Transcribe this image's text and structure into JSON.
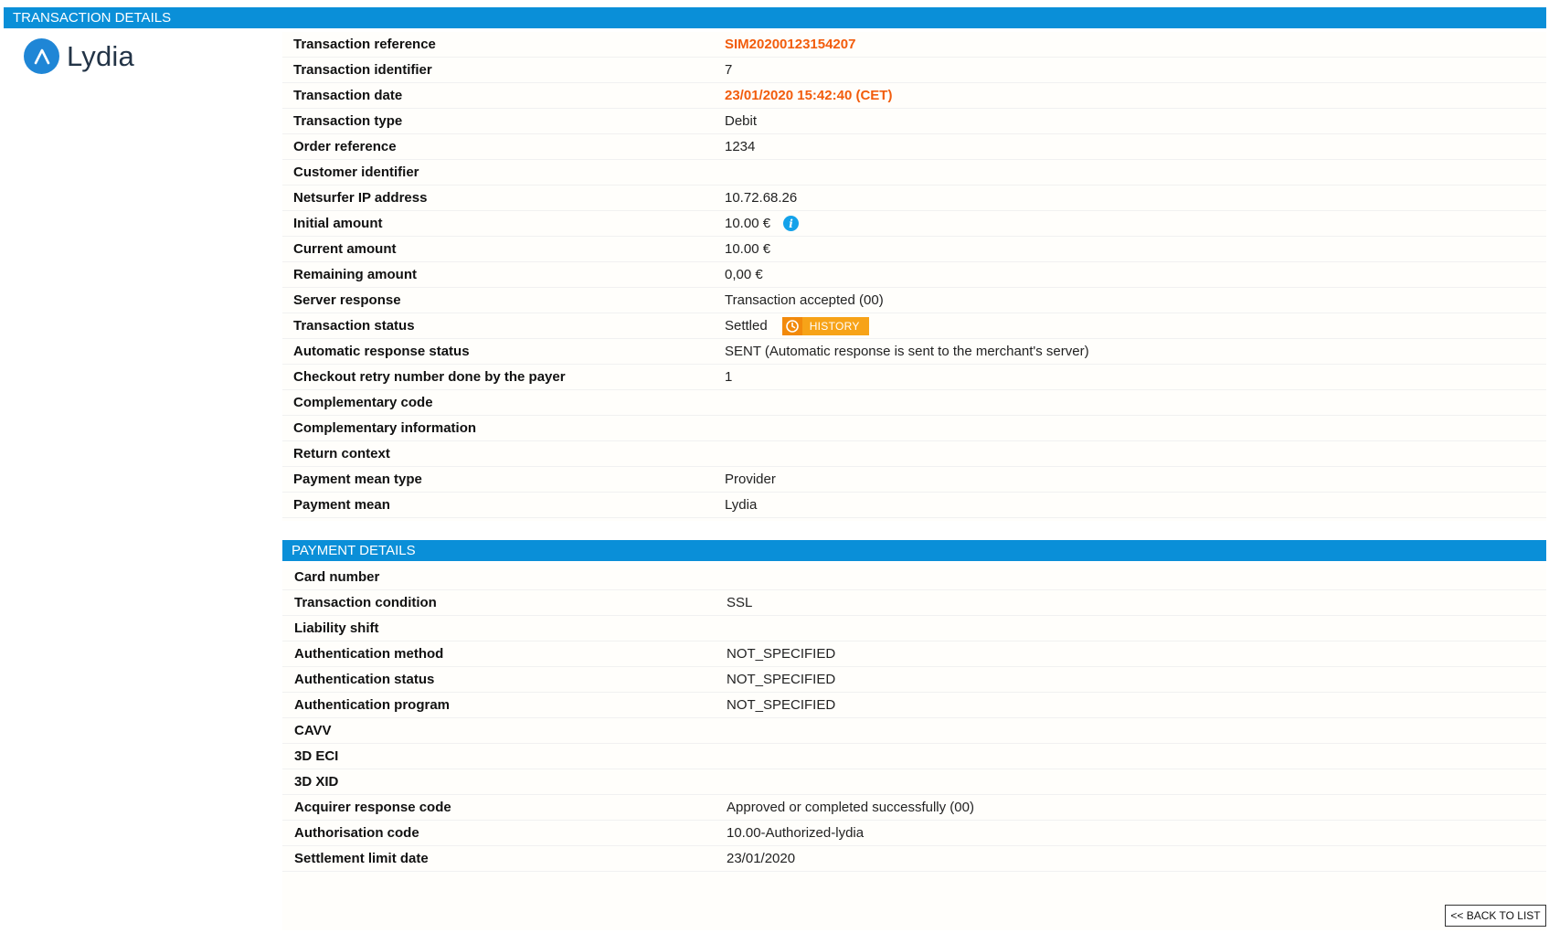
{
  "transaction_details": {
    "header": "TRANSACTION DETAILS",
    "logo_text": "Lydia",
    "rows": [
      {
        "label": "Transaction reference",
        "value": "SIM20200123154207"
      },
      {
        "label": "Transaction identifier",
        "value": "7"
      },
      {
        "label": "Transaction date",
        "value": "23/01/2020 15:42:40 (CET)"
      },
      {
        "label": "Transaction type",
        "value": "Debit"
      },
      {
        "label": "Order reference",
        "value": "1234"
      },
      {
        "label": "Customer identifier",
        "value": ""
      },
      {
        "label": "Netsurfer IP address",
        "value": "10.72.68.26"
      },
      {
        "label": "Initial amount",
        "value": "10.00 €"
      },
      {
        "label": "Current amount",
        "value": "10.00 €"
      },
      {
        "label": "Remaining amount",
        "value": "0,00 €"
      },
      {
        "label": "Server response",
        "value": "Transaction accepted (00)"
      },
      {
        "label": "Transaction status",
        "value": "Settled"
      },
      {
        "label": "Automatic response status",
        "value": "SENT (Automatic response is sent to the merchant's server)"
      },
      {
        "label": "Checkout retry number done by the payer",
        "value": "1"
      },
      {
        "label": "Complementary code",
        "value": ""
      },
      {
        "label": "Complementary information",
        "value": ""
      },
      {
        "label": "Return context",
        "value": ""
      },
      {
        "label": "Payment mean type",
        "value": "Provider"
      },
      {
        "label": "Payment mean",
        "value": "Lydia"
      }
    ],
    "history_button": "HISTORY"
  },
  "payment_details": {
    "header": "PAYMENT DETAILS",
    "rows": [
      {
        "label": "Card number",
        "value": ""
      },
      {
        "label": "Transaction condition",
        "value": "SSL"
      },
      {
        "label": "Liability shift",
        "value": ""
      },
      {
        "label": "Authentication method",
        "value": "NOT_SPECIFIED"
      },
      {
        "label": "Authentication status",
        "value": "NOT_SPECIFIED"
      },
      {
        "label": "Authentication program",
        "value": "NOT_SPECIFIED"
      },
      {
        "label": "CAVV",
        "value": ""
      },
      {
        "label": "3D ECI",
        "value": ""
      },
      {
        "label": "3D XID",
        "value": ""
      },
      {
        "label": "Acquirer response code",
        "value": "Approved or completed successfully (00)"
      },
      {
        "label": "Authorisation code",
        "value": "10.00-Authorized-lydia"
      },
      {
        "label": "Settlement limit date",
        "value": "23/01/2020"
      }
    ]
  },
  "back_button": "<< BACK TO LIST",
  "colors": {
    "header_blue": "#0a8fd8",
    "highlight_orange": "#f25c0c",
    "history_orange": "#f7a318",
    "info_blue": "#14a2ea",
    "logo_blue": "#1f86d6"
  },
  "icons": {
    "logo": "lydia-logo-icon",
    "info": "info-icon",
    "history": "clock-history-icon"
  }
}
